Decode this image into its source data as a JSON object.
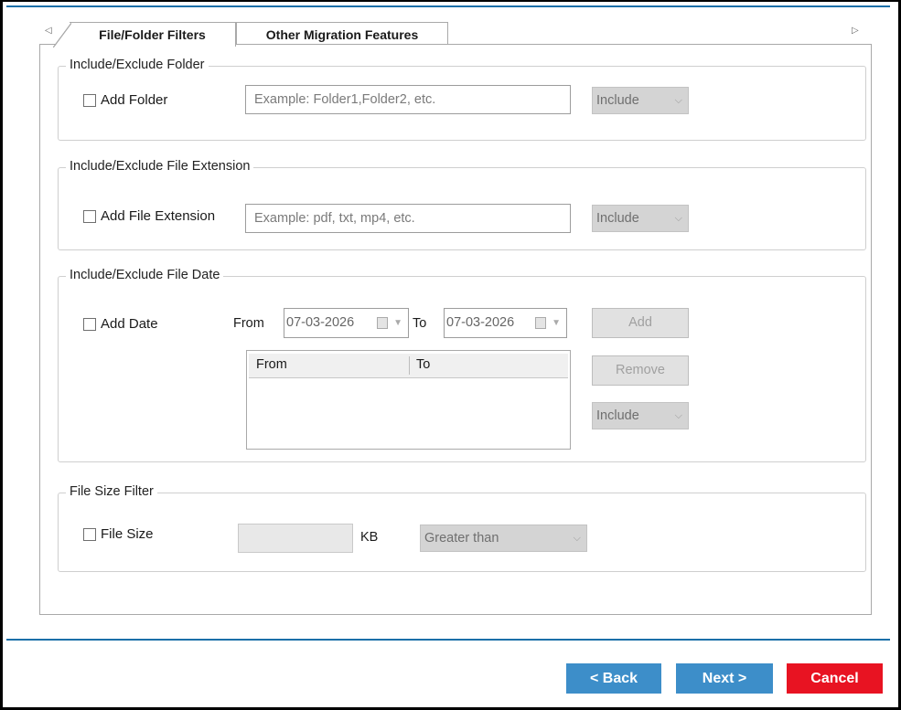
{
  "tabs": {
    "active_label": "File/Folder Filters",
    "inactive_label": "Other Migration Features",
    "scroll_left": "◁",
    "scroll_right": "▷"
  },
  "folder_group": {
    "legend": "Include/Exclude Folder",
    "checkbox_label": "Add Folder",
    "input_placeholder": "Example: Folder1,Folder2, etc.",
    "mode": "Include"
  },
  "extension_group": {
    "legend": "Include/Exclude File Extension",
    "checkbox_label": "Add File Extension",
    "input_placeholder": "Example: pdf, txt, mp4, etc.",
    "mode": "Include"
  },
  "date_group": {
    "legend": "Include/Exclude File Date",
    "checkbox_label": "Add Date",
    "from_label": "From",
    "from_value": "07-03-2026",
    "to_label": "To",
    "to_value": "07-03-2026",
    "add_button": "Add",
    "remove_button": "Remove",
    "mode": "Include",
    "list_columns": [
      "From",
      "To"
    ]
  },
  "size_group": {
    "legend": "File Size Filter",
    "checkbox_label": "File Size",
    "size_value": "",
    "unit": "KB",
    "comparison": "Greater than"
  },
  "footer": {
    "back_label": "< Back",
    "next_label": "Next >",
    "cancel_label": "Cancel"
  },
  "colors": {
    "primary_button": "#3d8ec9",
    "cancel_button": "#e81322",
    "divider": "#1a6fa8"
  }
}
